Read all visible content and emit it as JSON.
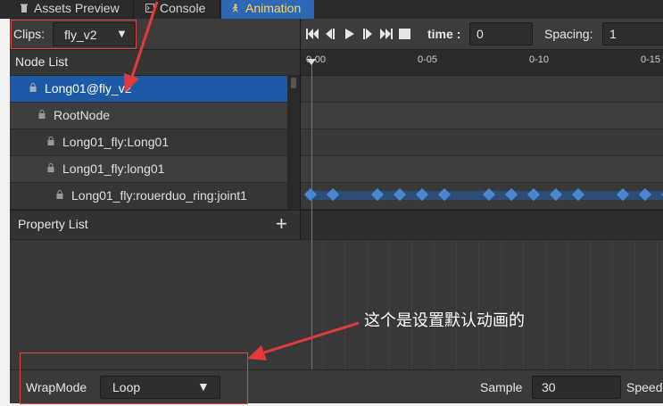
{
  "tabs": [
    {
      "label": "Assets Preview",
      "icon": "trash-icon"
    },
    {
      "label": "Console",
      "icon": "terminal-icon"
    },
    {
      "label": "Animation",
      "icon": "running-figure-icon",
      "active": true
    }
  ],
  "clips": {
    "label": "Clips:",
    "selected": "fly_v2"
  },
  "node_list": {
    "header": "Node List",
    "items": [
      {
        "label": "Long01@fly_v2",
        "depth": 0,
        "selected": true
      },
      {
        "label": "RootNode",
        "depth": 1
      },
      {
        "label": "Long01_fly:Long01",
        "depth": 2
      },
      {
        "label": "Long01_fly:long01",
        "depth": 2
      },
      {
        "label": "Long01_fly:rouerduo_ring:joint1",
        "depth": 3
      }
    ]
  },
  "property_list": {
    "header": "Property List",
    "add_label": "+"
  },
  "toolbar": {
    "buttons": [
      "go-start-icon",
      "prev-frame-icon",
      "play-icon",
      "next-frame-icon",
      "go-end-icon",
      "stop-icon"
    ],
    "time_label": "time",
    "time_sep": ":",
    "time_value": "0",
    "spacing_label": "Spacing:",
    "spacing_value": "1"
  },
  "ruler": {
    "labels": [
      "0-00",
      "0-05",
      "0-10",
      "0-15"
    ]
  },
  "keyframes": {
    "track": "Long01_fly:rouerduo_ring:joint1",
    "frames": [
      0,
      1,
      3,
      4,
      5,
      6,
      8,
      9,
      10,
      11,
      12,
      14,
      15,
      16
    ]
  },
  "footer": {
    "wrap_label": "WrapMode",
    "wrap_value": "Loop",
    "sample_label": "Sample",
    "sample_value": "30",
    "speed_label": "Speed"
  },
  "annotation": "这个是设置默认动画的",
  "colors": {
    "accent": "#2d68b5",
    "active_tab_text": "#ffd35c",
    "keyframe": "#4b86d0",
    "playhead": "#e04545",
    "highlight_box": "#e04545"
  }
}
